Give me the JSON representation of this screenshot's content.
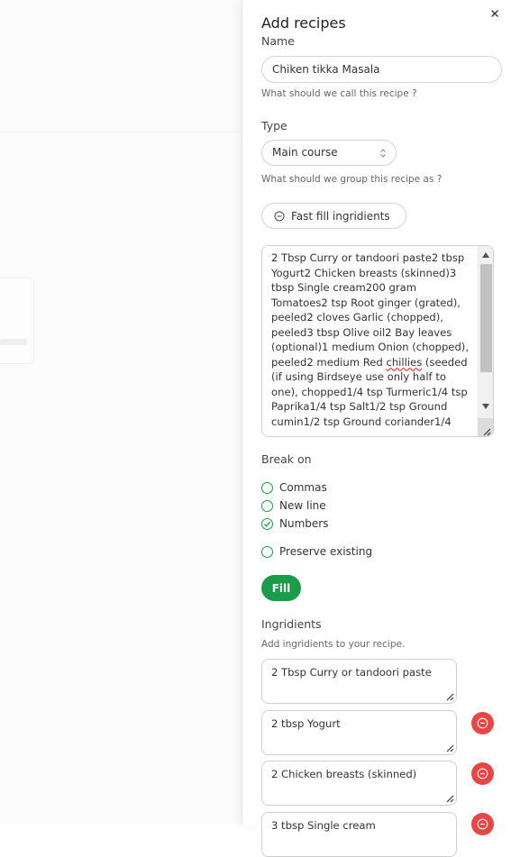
{
  "drawer": {
    "title": "Add recipes",
    "close_icon": "close-icon"
  },
  "name_field": {
    "label": "Name",
    "value": "Chiken tikka Masala",
    "help": "What should we call this recipe ?"
  },
  "type_field": {
    "label": "Type",
    "selected": "Main course",
    "help": "What should we group this recipe as ?"
  },
  "fast_fill": {
    "button_label": "Fast fill ingridients",
    "icon": "minus-circle-icon",
    "bulk_text_before": "2 Tbsp Curry or tandoori paste2 tbsp Yogurt2 Chicken breasts (skinned)3 tbsp Single cream200 gram Tomatoes2 tsp Root ginger (grated), peeled2 cloves Garlic (chopped), peeled3 tbsp Olive oil2 Bay leaves (optional)1 medium Onion (chopped), peeled2 medium Red ",
    "bulk_text_misspelled": "chillies",
    "bulk_text_after": " (seeded (if using Birdseye use only half to one), chopped1/4 tsp Turmeric1/4 tsp Paprika1/4 tsp Salt1/2 tsp Ground cumin1/2 tsp Ground coriander1/4"
  },
  "break_on": {
    "label": "Break on",
    "options": [
      {
        "label": "Commas",
        "checked": false
      },
      {
        "label": "New line",
        "checked": false
      },
      {
        "label": "Numbers",
        "checked": true
      }
    ],
    "preserve": {
      "label": "Preserve existing",
      "checked": false
    }
  },
  "fill_button": {
    "label": "Fill"
  },
  "ingredients": {
    "label": "Ingridients",
    "help": "Add ingridients to your recipe.",
    "items": [
      "2 Tbsp Curry or tandoori paste",
      "2 tbsp Yogurt",
      "2 Chicken breasts (skinned)",
      "3 tbsp Single cream"
    ],
    "remove_icon": "minus-circle-icon"
  },
  "colors": {
    "accent_green": "#1a9c4a",
    "danger_red": "#e84545"
  }
}
